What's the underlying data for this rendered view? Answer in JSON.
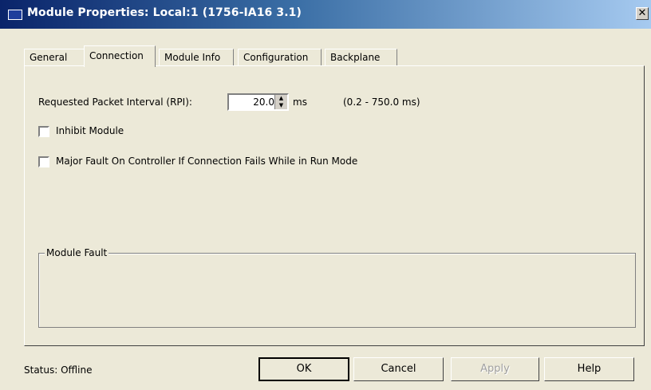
{
  "window": {
    "title": "Module Properties: Local:1 (1756-IA16 3.1)",
    "close_glyph": "✕"
  },
  "tabs": [
    {
      "label": "General",
      "active": false
    },
    {
      "label": "Connection",
      "active": true
    },
    {
      "label": "Module Info",
      "active": false
    },
    {
      "label": "Configuration",
      "active": false
    },
    {
      "label": "Backplane",
      "active": false
    }
  ],
  "connection": {
    "rpi_label": "Requested Packet Interval (RPI):",
    "rpi_value": "20.0",
    "rpi_units": "ms",
    "rpi_range": "(0.2 - 750.0 ms)",
    "inhibit_label": "Inhibit Module",
    "inhibit_checked": false,
    "major_fault_label": "Major Fault On Controller If Connection Fails While in Run Mode",
    "major_fault_checked": false,
    "module_fault_title": "Module Fault"
  },
  "footer": {
    "status": "Status:  Offline",
    "ok": "OK",
    "cancel": "Cancel",
    "apply": "Apply",
    "help": "Help"
  },
  "colors": {
    "title_gradient_start": "#0a246a",
    "title_gradient_end": "#a6caf0",
    "dialog_face": "#ece9d8"
  }
}
